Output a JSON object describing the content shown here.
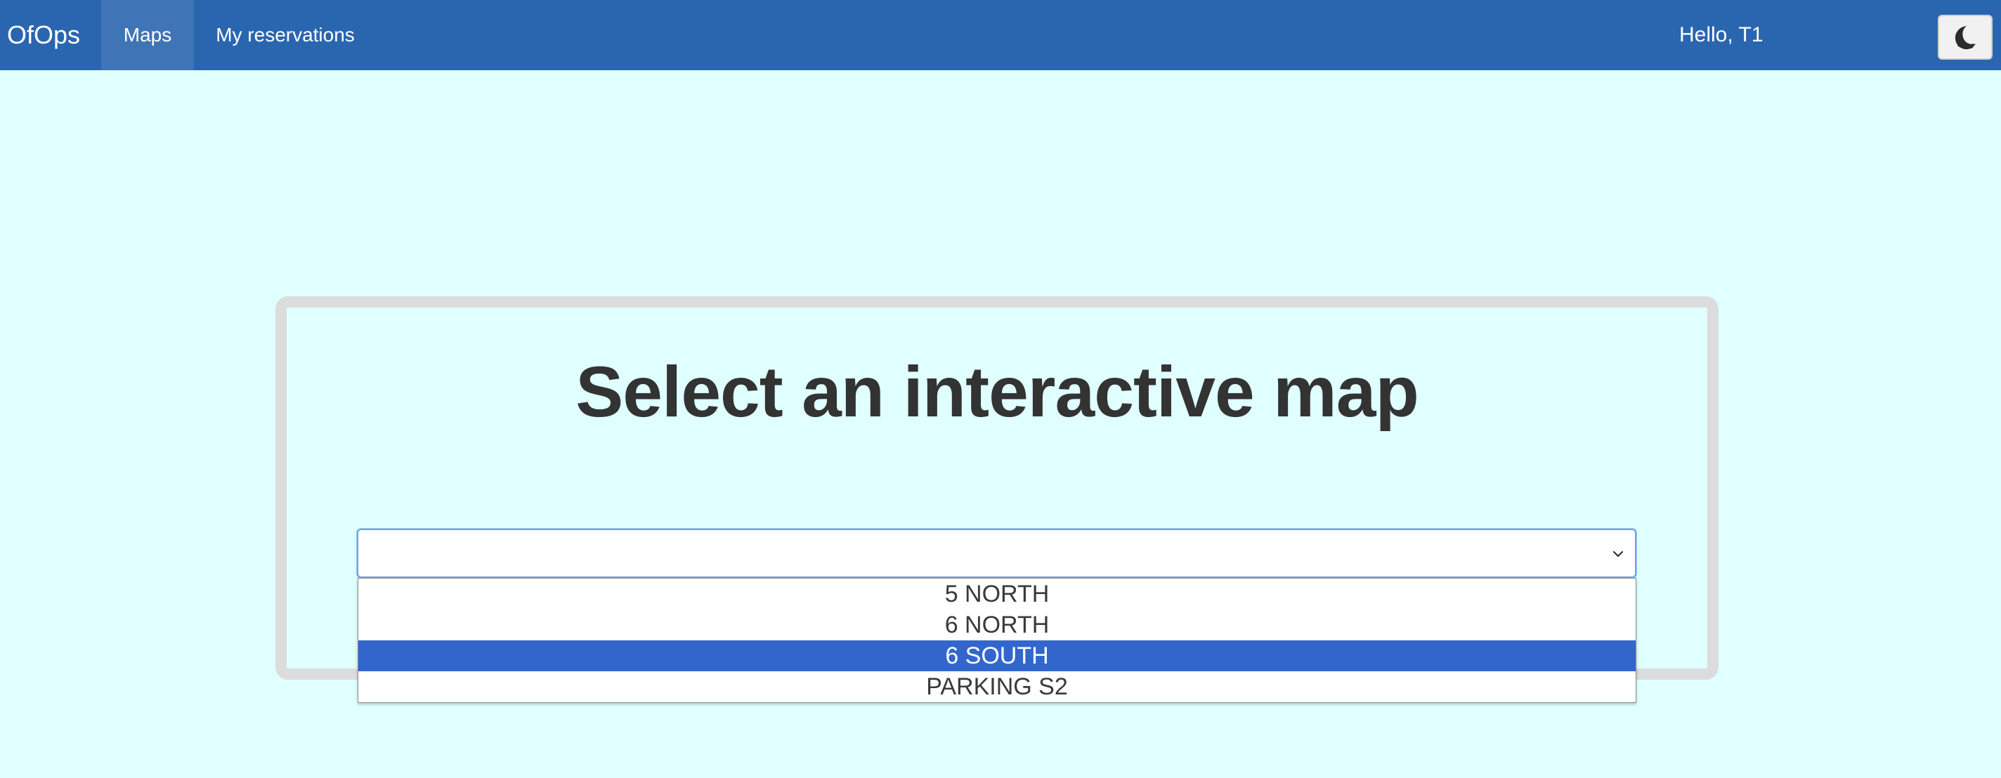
{
  "navbar": {
    "brand": "OfOps",
    "items": [
      {
        "label": "Maps",
        "active": true
      },
      {
        "label": "My reservations",
        "active": false
      }
    ],
    "greeting": "Hello, T1",
    "theme_toggle_icon": "moon-icon"
  },
  "main": {
    "title": "Select an interactive map",
    "select": {
      "value": "",
      "icon": "chevron-down-icon",
      "options": [
        {
          "label": "5 NORTH",
          "highlighted": false
        },
        {
          "label": "6 NORTH",
          "highlighted": false
        },
        {
          "label": "6 SOUTH",
          "highlighted": true
        },
        {
          "label": "PARKING S2",
          "highlighted": false
        }
      ]
    }
  },
  "colors": {
    "navbar_bg": "#2a66b0",
    "active_nav_bg": "#3f74b7",
    "page_bg": "#e0ffff",
    "card_border": "#dcdcdc",
    "option_highlight": "#3366cc",
    "title_text": "#333333"
  }
}
